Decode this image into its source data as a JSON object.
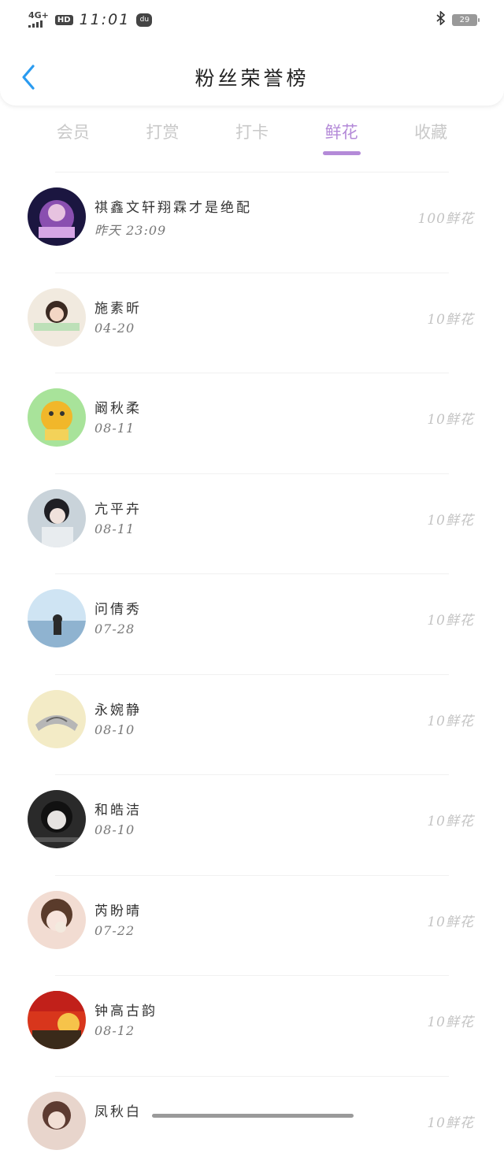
{
  "status_bar": {
    "network": "4G+",
    "hd": "HD",
    "time": "11:01",
    "app_badge": "du",
    "battery": "29"
  },
  "header": {
    "title": "粉丝荣誉榜"
  },
  "tabs": [
    {
      "label": "会员",
      "active": false
    },
    {
      "label": "打赏",
      "active": false
    },
    {
      "label": "打卡",
      "active": false
    },
    {
      "label": "鲜花",
      "active": true
    },
    {
      "label": "收藏",
      "active": false
    }
  ],
  "fans": [
    {
      "name": "祺鑫文轩翔霖才是绝配",
      "date": "昨天 23:09",
      "amount": "100鲜花",
      "avatar": "avatar-1"
    },
    {
      "name": "施素昕",
      "date": "04-20",
      "amount": "10鲜花",
      "avatar": "avatar-2"
    },
    {
      "name": "阚秋柔",
      "date": "08-11",
      "amount": "10鲜花",
      "avatar": "avatar-3"
    },
    {
      "name": "亢平卉",
      "date": "08-11",
      "amount": "10鲜花",
      "avatar": "avatar-4"
    },
    {
      "name": "问倩秀",
      "date": "07-28",
      "amount": "10鲜花",
      "avatar": "avatar-5"
    },
    {
      "name": "永婉静",
      "date": "08-10",
      "amount": "10鲜花",
      "avatar": "avatar-6"
    },
    {
      "name": "和皓洁",
      "date": "08-10",
      "amount": "10鲜花",
      "avatar": "avatar-7"
    },
    {
      "name": "芮盼晴",
      "date": "07-22",
      "amount": "10鲜花",
      "avatar": "avatar-8"
    },
    {
      "name": "钟高古韵",
      "date": "08-12",
      "amount": "10鲜花",
      "avatar": "avatar-9"
    },
    {
      "name": "凤秋白",
      "date": "",
      "amount": "10鲜花",
      "avatar": "avatar-10"
    }
  ],
  "colors": {
    "accent": "#b48ad8",
    "back": "#2a9bf0",
    "inactive_tab": "#c9c9c9",
    "amount": "#c4c4c4"
  }
}
